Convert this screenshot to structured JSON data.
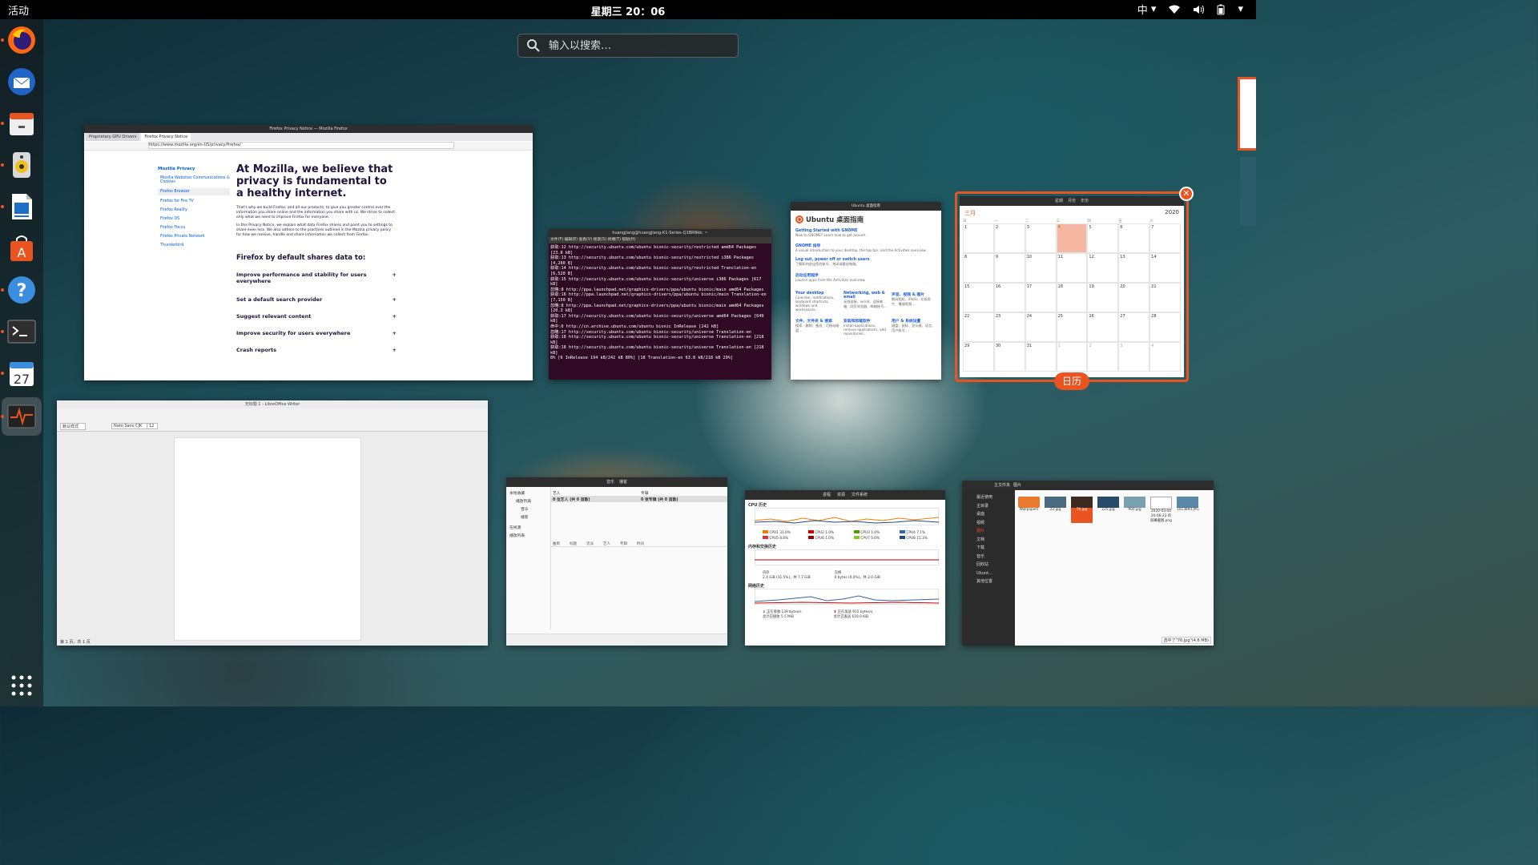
{
  "topbar": {
    "activities": "活动",
    "clock": "星期三 20：06",
    "input_method": "中"
  },
  "search": {
    "placeholder": "输入以搜索…"
  },
  "dock": {
    "items": [
      {
        "name": "firefox"
      },
      {
        "name": "thunderbird"
      },
      {
        "name": "files"
      },
      {
        "name": "rhythmbox"
      },
      {
        "name": "writer"
      },
      {
        "name": "software"
      },
      {
        "name": "help"
      },
      {
        "name": "terminal"
      },
      {
        "name": "calendar",
        "badge": "27"
      },
      {
        "name": "system-monitor"
      }
    ]
  },
  "firefox": {
    "window_title": "Firefox Privacy Notice — Mozilla Firefox",
    "tab1": "Proprietary GPU Drivers",
    "tab2": "Firefox Privacy Notice",
    "url": "https://www.mozilla.org/en-US/privacy/firefox/",
    "sidebar": [
      "Mozilla Privacy",
      "Mozilla Websites Communications & Cookies",
      "Firefox Browser",
      "Firefox for Fire TV",
      "Firefox Reality",
      "Firefox OS",
      "Firefox Focus",
      "Firefox Private Network",
      "Thunderbird"
    ],
    "heading": "At Mozilla, we believe that privacy is fundamental to a healthy internet.",
    "para1": "That's why we build Firefox, and all our products, to give you greater control over the information you share online and the information you share with us. We strive to collect only what we need to improve Firefox for everyone.",
    "para2": "In this Privacy Notice, we explain what data Firefox shares and point you to settings to share even less. We also adhere to the practices outlined in the Mozilla privacy policy for how we receive, handle and share information we collect from Firefox.",
    "subheading": "Firefox by default shares data to:",
    "items": [
      "Improve performance and stability for users everywhere",
      "Set a default search provider",
      "Suggest relevant content",
      "Improve security for users everywhere",
      "Crash reports"
    ]
  },
  "terminal": {
    "title": "huangjiang@huangjiang-K1-Series-Q1BRNkk: ~",
    "menu": "文件(F)  编辑(E)  查看(V)  搜索(S)  终端(T)  帮助(H)",
    "lines": [
      "获取:12 http://security.ubuntu.com/ubuntu bionic-security/restricted amd64 Packages [23.8 kB]",
      "获取:13 http://security.ubuntu.com/ubuntu bionic-security/restricted i386 Packages [4,280 B]",
      "获取:14 http://security.ubuntu.com/ubuntu bionic-security/restricted Translation-en [6,520 B]",
      "获取:15 http://security.ubuntu.com/ubuntu bionic-security/universe i386 Packages [617 kB]",
      "忽略:8 http://ppa.launchpad.net/graphics-drivers/ppa/ubuntu bionic/main amd64 Packages",
      "获取:16 http://ppa.launchpad.net/graphics-drivers/ppa/ubuntu bionic/main Translation-en [7,150 B]",
      "忽略:8 http://ppa.launchpad.net/graphics-drivers/ppa/ubuntu bionic/main amd64 Packages [20.3 kB]",
      "获取:17 http://security.ubuntu.com/ubuntu bionic-security/universe amd64 Packages [649 kB]",
      "命中:6 http://cn.archive.ubuntu.com/ubuntu bionic InRelease [242 kB]",
      "忽略:17 http://security.ubuntu.com/ubuntu bionic-security/universe Translation-en",
      "获取:18 http://security.ubuntu.com/ubuntu bionic-security/universe Translation-en [218 kB]",
      "获取:18 http://security.ubuntu.com/ubuntu bionic-security/universe Translation-en [218 kB]",
      "8% [6 InRelease 194 kB/242 kB 80%] [18 Translation-en 63.8 kB/218 kB 29%]"
    ]
  },
  "ubuntu_guide": {
    "title": "Ubuntu 桌面指南",
    "links": [
      {
        "title": "Getting Started with GNOME",
        "desc": "New to GNOME? Learn how to get around."
      },
      {
        "title": "GNOME 指导",
        "desc": "A visual introduction to your desktop, the top bar, and the Activities overview."
      },
      {
        "title": "Log out, power off or switch users",
        "desc": "了解如何退出您的账号、关闭或重启电脑。"
      },
      {
        "title": "启动应用程序",
        "desc": "Launch apps from the Activities overview."
      }
    ],
    "grid": [
      {
        "title": "Your desktop",
        "desc": "Calendar, notifications, keyboard shortcuts, windows and workspaces…"
      },
      {
        "title": "Networking, web & email",
        "desc": "无线连接、wired、连接邮箱、网页浏览器、邮箱账号…"
      },
      {
        "title": "声音、视频 & 图片",
        "desc": "数码相机、iPods、光驱照片、播放视频…"
      },
      {
        "title": "文件、文件夹 & 搜索",
        "desc": "搜索、删除、备份、可移动磁盘…"
      },
      {
        "title": "安装和卸载软件",
        "desc": "Install applications, remove applications, add repositories…"
      },
      {
        "title": "用户 & 系统设置",
        "desc": "键盘、鼠标、显示器、语言、用户账号…"
      }
    ]
  },
  "calendar": {
    "month": "三月",
    "year": "2020",
    "tabs": [
      "星期",
      "月份",
      "年份"
    ],
    "weekdays": [
      "日",
      "一",
      "二",
      "三",
      "四",
      "五",
      "六"
    ],
    "rows": [
      [
        "1",
        "2",
        "3",
        "4",
        "5",
        "6",
        "7"
      ],
      [
        "8",
        "9",
        "10",
        "11",
        "12",
        "13",
        "14"
      ],
      [
        "15",
        "16",
        "17",
        "18",
        "19",
        "20",
        "21"
      ],
      [
        "22",
        "23",
        "24",
        "25",
        "26",
        "27",
        "28"
      ],
      [
        "29",
        "30",
        "31",
        "1",
        "2",
        "3",
        "4"
      ]
    ],
    "today": "4",
    "label": "日历"
  },
  "writer": {
    "title": "无标题 1 - LibreOffice Writer",
    "style": "默认样式",
    "font": "Noto Sans CJK",
    "size": "12",
    "status": "第 1 页，共 1 页"
  },
  "rhythmbox": {
    "tabs": [
      "音乐",
      "播客"
    ],
    "side": [
      "本地收藏",
      "播放列表",
      "音乐",
      "播客",
      "在线源",
      "播放列表"
    ],
    "cols": [
      "艺人",
      "专辑"
    ],
    "row": [
      "0 位艺人 (共 0 首歌)",
      "0 张专辑 (共 0 首歌)"
    ],
    "cols2": [
      "曲目",
      "标题",
      "流派",
      "艺人",
      "专辑",
      "时间"
    ]
  },
  "sysmon": {
    "tabs": [
      "进程",
      "资源",
      "文件系统"
    ],
    "cpu_title": "CPU 历史",
    "cpu": [
      {
        "label": "CPU1 31.0%",
        "color": "#f57900"
      },
      {
        "label": "CPU2 1.0%",
        "color": "#cc0000"
      },
      {
        "label": "CPU3 1.0%",
        "color": "#4e9a06"
      },
      {
        "label": "CPU4 7.1%",
        "color": "#3465a4"
      },
      {
        "label": "CPU5 8.8%",
        "color": "#ef2929"
      },
      {
        "label": "CPU6 1.0%",
        "color": "#a40000"
      },
      {
        "label": "CPU7 0.0%",
        "color": "#73d216"
      },
      {
        "label": "CPU8 15.3%",
        "color": "#204a87"
      }
    ],
    "mem_title": "内存和交换历史",
    "mem": "内存",
    "mem_val": "2.4 GiB (31.5%)，共 7.7 GiB",
    "swap": "交换",
    "swap_val": "0 bytes (0.0%)，共 2.0 GiB",
    "net_title": "网络历史",
    "recv": "正在接收",
    "recv_rate": "139 bytes/s",
    "recv_total_label": "总计已接收",
    "recv_total": "5.5 MiB",
    "send": "正在发送",
    "send_rate": "915 bytes/s",
    "send_total_label": "总计已发送",
    "send_total": "610.0 KiB"
  },
  "files": {
    "crumbs": [
      "主文件夹",
      "图片"
    ],
    "side": [
      "最近使用",
      "主目录",
      "桌面",
      "视频",
      "图片",
      "文档",
      "下载",
      "音乐",
      "回收站",
      "Ubunt…",
      "其他位置"
    ],
    "items": [
      "Wallpapers",
      "22.jpg",
      "76.jpg",
      "225.jpg",
      "900.jpg",
      "2020-03-04 20-06-23 的屏幕截图.png",
      "1013894.JPG"
    ],
    "status": "选中了\"76.jpg\"(4.6 MB)"
  }
}
